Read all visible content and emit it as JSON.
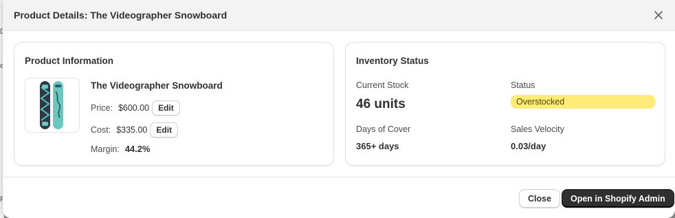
{
  "background": {
    "edge_fragments": [
      "D",
      "e",
      "F"
    ]
  },
  "modal": {
    "title": "Product Details: The Videographer Snowboard",
    "close_icon": "close-icon"
  },
  "product_card": {
    "heading": "Product Information",
    "image_icon": "snowboard-image",
    "name": "The Videographer Snowboard",
    "price_label": "Price:",
    "price_value": "$600.00",
    "price_edit_label": "Edit",
    "cost_label": "Cost:",
    "cost_value": "$335.00",
    "cost_edit_label": "Edit",
    "margin_label": "Margin:",
    "margin_value": "44.2%"
  },
  "inventory_card": {
    "heading": "Inventory Status",
    "current_stock_label": "Current Stock",
    "current_stock_value": "46 units",
    "status_label": "Status",
    "status_value": "Overstocked",
    "status_color": "#ffeb78",
    "days_of_cover_label": "Days of Cover",
    "days_of_cover_value": "365+ days",
    "sales_velocity_label": "Sales Velocity",
    "sales_velocity_value": "0.03/day"
  },
  "footer": {
    "close_label": "Close",
    "primary_label": "Open in Shopify Admin"
  },
  "colors": {
    "primary_button": "#303030",
    "badge_warning": "#ffeb78"
  }
}
